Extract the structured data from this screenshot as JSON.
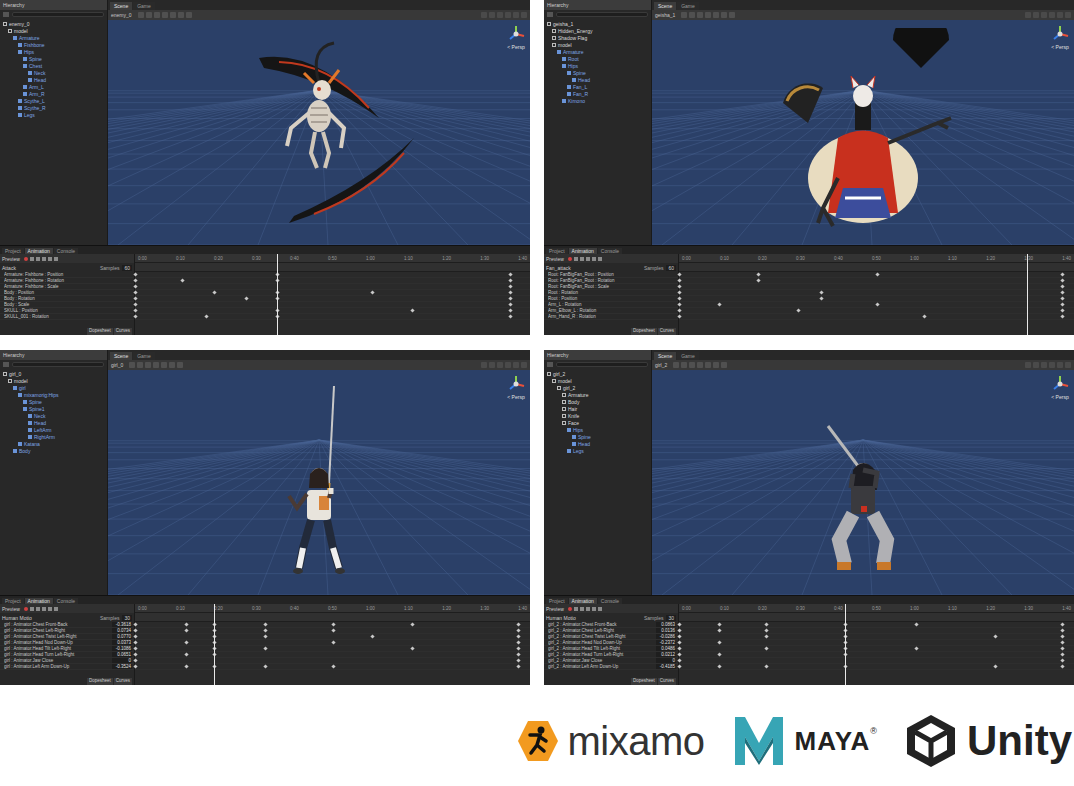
{
  "shots": [
    {
      "hierarchy_title": "Hierarchy",
      "scene_name": "enemy_0",
      "persp": "< Persp",
      "figure": "scythe",
      "scene_tabs": [
        {
          "label": "Scene",
          "selected": true
        },
        {
          "label": "Game",
          "selected": false
        }
      ],
      "tree": [
        {
          "label": "enemy_0",
          "depth": 0,
          "prefab": false
        },
        {
          "label": "model",
          "depth": 1,
          "prefab": false
        },
        {
          "label": "Armature",
          "depth": 2,
          "prefab": true
        },
        {
          "label": "Fishbone",
          "depth": 3,
          "prefab": true
        },
        {
          "label": "Hips",
          "depth": 3,
          "prefab": true
        },
        {
          "label": "Spine",
          "depth": 4,
          "prefab": true
        },
        {
          "label": "Chest",
          "depth": 4,
          "prefab": true
        },
        {
          "label": "Neck",
          "depth": 5,
          "prefab": true
        },
        {
          "label": "Head",
          "depth": 5,
          "prefab": true
        },
        {
          "label": "Arm_L",
          "depth": 4,
          "prefab": true
        },
        {
          "label": "Arm_R",
          "depth": 4,
          "prefab": true
        },
        {
          "label": "Scythe_L",
          "depth": 3,
          "prefab": true
        },
        {
          "label": "Scythe_R",
          "depth": 3,
          "prefab": true
        },
        {
          "label": "Legs",
          "depth": 3,
          "prefab": true
        }
      ],
      "bottom_tabs": [
        {
          "label": "Project",
          "selected": false
        },
        {
          "label": "Animation",
          "selected": true
        },
        {
          "label": "Console",
          "selected": false
        }
      ],
      "preview": "Preview",
      "clip": "Attack",
      "samples": "Samples",
      "rate": "60",
      "ruler": [
        "0:00",
        "0:10",
        "0:20",
        "0:30",
        "0:40",
        "0:50",
        "1:00",
        "1:10",
        "1:20",
        "1:30",
        "1:40"
      ],
      "playhead": 0.36,
      "tracks": [
        {
          "label": "Armature: Fishbone : Position",
          "keys": [
            0,
            0.36,
            0.95
          ]
        },
        {
          "label": "Armature: Fishbone : Rotation",
          "keys": [
            0,
            0.12,
            0.36,
            0.95
          ]
        },
        {
          "label": "Armature: Fishbone : Scale",
          "keys": [
            0,
            0.95
          ]
        },
        {
          "label": "Body : Position",
          "keys": [
            0,
            0.2,
            0.36,
            0.6,
            0.95
          ]
        },
        {
          "label": "Body : Rotation",
          "keys": [
            0,
            0.28,
            0.36,
            0.95
          ]
        },
        {
          "label": "Body : Scale",
          "keys": [
            0,
            0.95
          ]
        },
        {
          "label": "SKULL : Position",
          "keys": [
            0,
            0.36,
            0.7,
            0.95
          ]
        },
        {
          "label": "SKULL_001 : Rotation",
          "keys": [
            0,
            0.18,
            0.36,
            0.95
          ]
        }
      ],
      "footer": [
        "Dopesheet",
        "Curves"
      ]
    },
    {
      "hierarchy_title": "Hierarchy",
      "scene_name": "geisha_1",
      "persp": "< Persp",
      "figure": "fans",
      "scene_tabs": [
        {
          "label": "Scene",
          "selected": true
        },
        {
          "label": "Game",
          "selected": false
        }
      ],
      "tree": [
        {
          "label": "geisha_1",
          "depth": 0,
          "prefab": false
        },
        {
          "label": "Hidden_Energy",
          "depth": 1,
          "prefab": false
        },
        {
          "label": "Shadow Flag",
          "depth": 1,
          "prefab": false
        },
        {
          "label": "model",
          "depth": 1,
          "prefab": false
        },
        {
          "label": "Armature",
          "depth": 2,
          "prefab": true
        },
        {
          "label": "Root",
          "depth": 3,
          "prefab": true
        },
        {
          "label": "Hips",
          "depth": 3,
          "prefab": true
        },
        {
          "label": "Spine",
          "depth": 4,
          "prefab": true
        },
        {
          "label": "Head",
          "depth": 5,
          "prefab": true
        },
        {
          "label": "Fan_L",
          "depth": 4,
          "prefab": true
        },
        {
          "label": "Fan_R",
          "depth": 4,
          "prefab": true
        },
        {
          "label": "Kimono",
          "depth": 3,
          "prefab": true
        }
      ],
      "bottom_tabs": [
        {
          "label": "Project",
          "selected": false
        },
        {
          "label": "Animation",
          "selected": true
        },
        {
          "label": "Console",
          "selected": false
        }
      ],
      "preview": "Preview",
      "clip": "Fan_attack",
      "samples": "Samples",
      "rate": "60",
      "ruler": [
        "0:00",
        "0:10",
        "0:20",
        "0:30",
        "0:40",
        "0:50",
        "1:00",
        "1:10",
        "1:20",
        "1:30",
        "1:40"
      ],
      "playhead": 0.88,
      "tracks": [
        {
          "label": "Root: FanBigFan_Root : Position",
          "keys": [
            0,
            0.2,
            0.5,
            0.97
          ]
        },
        {
          "label": "Root: FanBigFan_Root : Rotation",
          "keys": [
            0,
            0.2,
            0.97
          ]
        },
        {
          "label": "Root: FanBigFan_Root : Scale",
          "keys": [
            0,
            0.97
          ]
        },
        {
          "label": "Root : Rotation",
          "keys": [
            0,
            0.36,
            0.97
          ]
        },
        {
          "label": "Root : Position",
          "keys": [
            0,
            0.36,
            0.97
          ]
        },
        {
          "label": "Arm_L : Rotation",
          "keys": [
            0,
            0.1,
            0.5,
            0.97
          ]
        },
        {
          "label": "Arm_Elbow_L : Rotation",
          "keys": [
            0,
            0.3,
            0.97
          ]
        },
        {
          "label": "Arm_Hand_R : Rotation",
          "keys": [
            0,
            0.62,
            0.97
          ]
        }
      ],
      "footer": [
        "Dopesheet",
        "Curves"
      ]
    },
    {
      "hierarchy_title": "Hierarchy",
      "scene_name": "girl_0",
      "persp": "< Persp",
      "figure": "katana",
      "scene_tabs": [
        {
          "label": "Scene",
          "selected": true
        },
        {
          "label": "Game",
          "selected": false
        }
      ],
      "tree": [
        {
          "label": "girl_0",
          "depth": 0,
          "prefab": false
        },
        {
          "label": "model",
          "depth": 1,
          "prefab": false
        },
        {
          "label": "girl",
          "depth": 2,
          "prefab": true
        },
        {
          "label": "mixamorig:Hips",
          "depth": 3,
          "prefab": true
        },
        {
          "label": "Spine",
          "depth": 4,
          "prefab": true
        },
        {
          "label": "Spine1",
          "depth": 4,
          "prefab": true
        },
        {
          "label": "Neck",
          "depth": 5,
          "prefab": true
        },
        {
          "label": "Head",
          "depth": 5,
          "prefab": true
        },
        {
          "label": "LeftArm",
          "depth": 5,
          "prefab": true
        },
        {
          "label": "RightArm",
          "depth": 5,
          "prefab": true
        },
        {
          "label": "Katana",
          "depth": 3,
          "prefab": true
        },
        {
          "label": "Body",
          "depth": 2,
          "prefab": true
        }
      ],
      "bottom_tabs": [
        {
          "label": "Project",
          "selected": false
        },
        {
          "label": "Animation",
          "selected": true
        },
        {
          "label": "Console",
          "selected": false
        }
      ],
      "preview": "Preview",
      "clip": "Human Motio",
      "samples": "Samples",
      "rate": "30",
      "ruler": [
        "0:00",
        "0:10",
        "0:20",
        "0:30",
        "0:40",
        "0:50",
        "1:00",
        "1:10",
        "1:20",
        "1:30",
        "1:40"
      ],
      "playhead": 0.2,
      "tracks": [
        {
          "label": "girl : Animator.Chest Front-Back",
          "value": "-0.3618",
          "keys": [
            0,
            0.13,
            0.2,
            0.33,
            0.5,
            0.7,
            0.97
          ]
        },
        {
          "label": "girl : Animator.Chest Left-Right",
          "value": "0.0734",
          "keys": [
            0,
            0.13,
            0.2,
            0.33,
            0.5,
            0.97
          ]
        },
        {
          "label": "girl : Animator.Chest Twist Left-Right",
          "value": "0.0770",
          "keys": [
            0,
            0.2,
            0.33,
            0.6,
            0.97
          ]
        },
        {
          "label": "girl : Animator.Head Nod Down-Up",
          "value": "0.0373",
          "keys": [
            0,
            0.13,
            0.2,
            0.5,
            0.97
          ]
        },
        {
          "label": "girl : Animator.Head Tilt Left-Right",
          "value": "-0.1086",
          "keys": [
            0,
            0.2,
            0.33,
            0.7,
            0.97
          ]
        },
        {
          "label": "girl : Animator.Head Turn Left-Right",
          "value": "0.0651",
          "keys": [
            0,
            0.13,
            0.2,
            0.97
          ]
        },
        {
          "label": "girl : Animator.Jaw Close",
          "value": "0",
          "keys": [
            0,
            0.97
          ]
        },
        {
          "label": "girl : Animator.Left Arm Down-Up",
          "value": "-0.3524",
          "keys": [
            0,
            0.13,
            0.2,
            0.33,
            0.5,
            0.97
          ]
        }
      ],
      "footer": [
        "Dopesheet",
        "Curves"
      ]
    },
    {
      "hierarchy_title": "Hierarchy",
      "scene_name": "girl_2",
      "persp": "< Persp",
      "figure": "dagger",
      "scene_tabs": [
        {
          "label": "Scene",
          "selected": true
        },
        {
          "label": "Game",
          "selected": false
        }
      ],
      "tree": [
        {
          "label": "girl_2",
          "depth": 0,
          "prefab": false
        },
        {
          "label": "model",
          "depth": 1,
          "prefab": false
        },
        {
          "label": "girl_2",
          "depth": 2,
          "prefab": false
        },
        {
          "label": "Armature",
          "depth": 3,
          "prefab": false
        },
        {
          "label": "Body",
          "depth": 3,
          "prefab": false
        },
        {
          "label": "Hair",
          "depth": 3,
          "prefab": false
        },
        {
          "label": "Knife",
          "depth": 3,
          "prefab": false
        },
        {
          "label": "Face",
          "depth": 3,
          "prefab": false
        },
        {
          "label": "Hips",
          "depth": 4,
          "prefab": true
        },
        {
          "label": "Spine",
          "depth": 5,
          "prefab": true
        },
        {
          "label": "Head",
          "depth": 5,
          "prefab": true
        },
        {
          "label": "Legs",
          "depth": 4,
          "prefab": true
        }
      ],
      "bottom_tabs": [
        {
          "label": "Project",
          "selected": false
        },
        {
          "label": "Animation",
          "selected": true
        },
        {
          "label": "Console",
          "selected": false
        }
      ],
      "preview": "Preview",
      "clip": "Human Motio",
      "samples": "Samples",
      "rate": "30",
      "ruler": [
        "0:00",
        "0:10",
        "0:20",
        "0:30",
        "0:40",
        "0:50",
        "1:00",
        "1:10",
        "1:20",
        "1:30",
        "1:40"
      ],
      "playhead": 0.42,
      "tracks": [
        {
          "label": "girl_2 : Animator.Chest Front-Back",
          "value": "0.0863",
          "keys": [
            0,
            0.1,
            0.22,
            0.42,
            0.6,
            0.97
          ]
        },
        {
          "label": "girl_2 : Animator.Chest Left-Right",
          "value": "0.0136",
          "keys": [
            0,
            0.1,
            0.22,
            0.42,
            0.97
          ]
        },
        {
          "label": "girl_2 : Animator.Chest Twist Left-Right",
          "value": "-0.0286",
          "keys": [
            0,
            0.22,
            0.42,
            0.8,
            0.97
          ]
        },
        {
          "label": "girl_2 : Animator.Head Nod Down-Up",
          "value": "-0.2372",
          "keys": [
            0,
            0.1,
            0.42,
            0.97
          ]
        },
        {
          "label": "girl_2 : Animator.Head Tilt Left-Right",
          "value": "0.0486",
          "keys": [
            0,
            0.22,
            0.42,
            0.6,
            0.97
          ]
        },
        {
          "label": "girl_2 : Animator.Head Turn Left-Right",
          "value": "0.0212",
          "keys": [
            0,
            0.1,
            0.42,
            0.97
          ]
        },
        {
          "label": "girl_2 : Animator.Jaw Close",
          "value": "0",
          "keys": [
            0,
            0.97
          ]
        },
        {
          "label": "girl_2 : Animator.Left Arm Down-Up",
          "value": "-0.4185",
          "keys": [
            0,
            0.1,
            0.22,
            0.42,
            0.8,
            0.97
          ]
        }
      ],
      "footer": [
        "Dopesheet",
        "Curves"
      ]
    }
  ],
  "logos": [
    {
      "name": "mixamo",
      "suffix": ""
    },
    {
      "name": "MAYA",
      "suffix": "®"
    },
    {
      "name": "Unity",
      "suffix": ""
    }
  ]
}
